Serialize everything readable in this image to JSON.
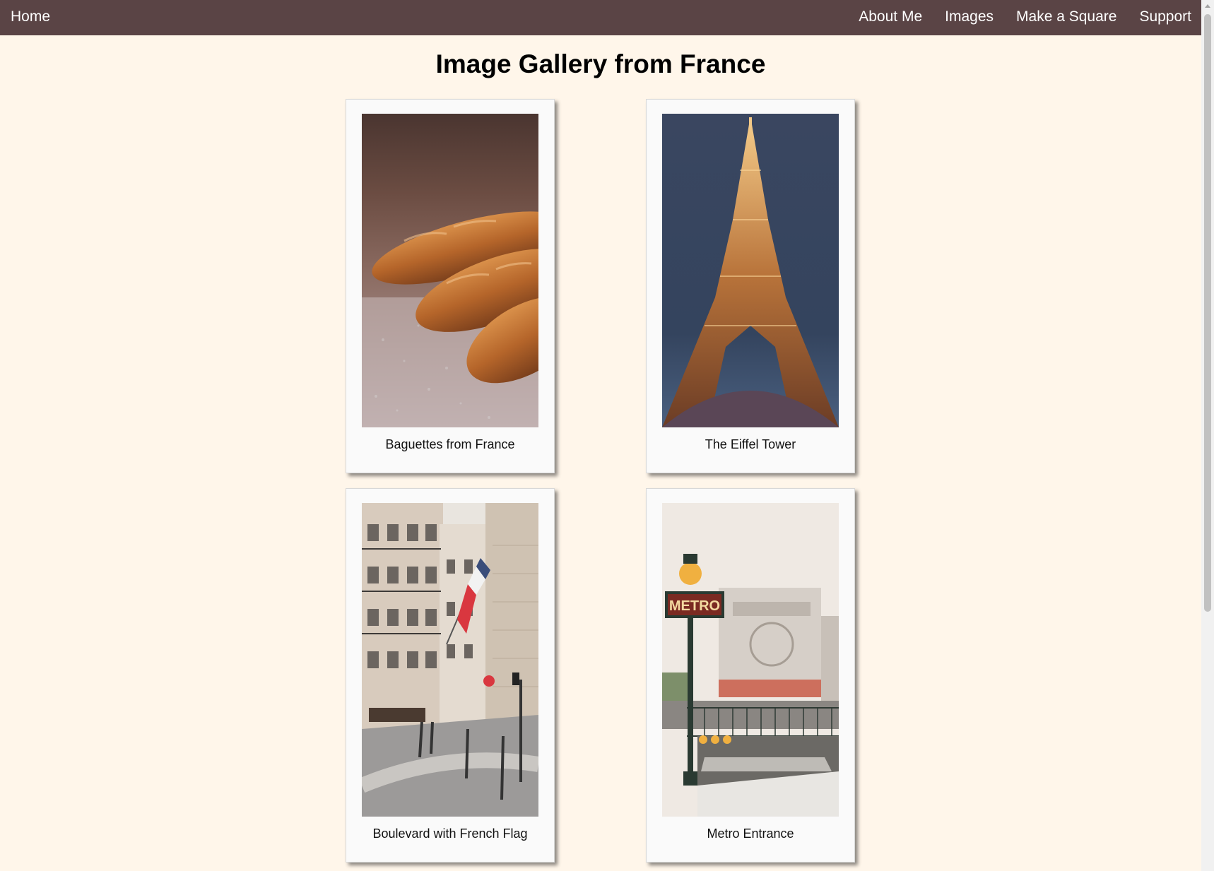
{
  "nav": {
    "home": "Home",
    "links": [
      "About Me",
      "Images",
      "Make a Square",
      "Support"
    ]
  },
  "page": {
    "title": "Image Gallery from France"
  },
  "gallery": [
    {
      "caption": "Baguettes from France",
      "image": "baguettes-photo"
    },
    {
      "caption": "The Eiffel Tower",
      "image": "eiffel-tower-photo"
    },
    {
      "caption": "Boulevard with French Flag",
      "image": "boulevard-flag-photo"
    },
    {
      "caption": "Metro Entrance",
      "image": "metro-entrance-photo"
    }
  ],
  "colors": {
    "navbar": "#5a4445",
    "background": "#fff6ea",
    "card": "#fafafa"
  }
}
